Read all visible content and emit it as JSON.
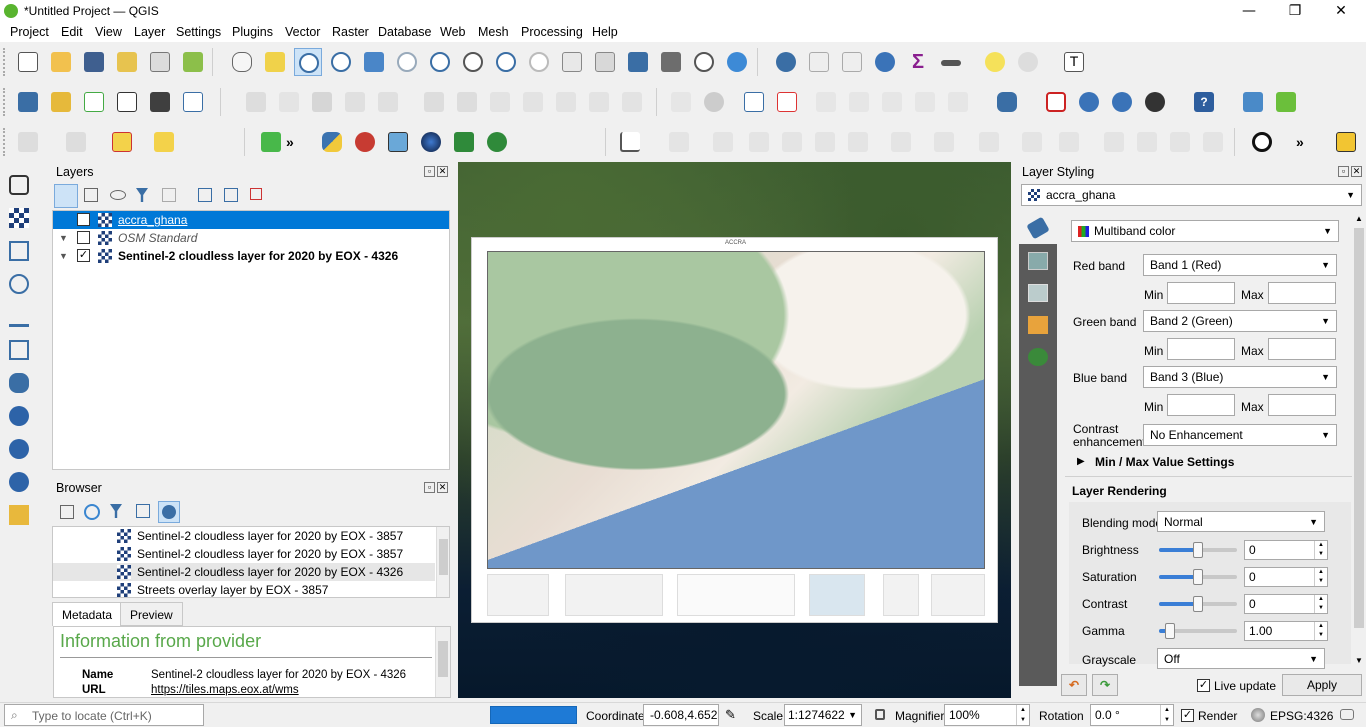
{
  "window": {
    "title": "*Untitled Project — QGIS"
  },
  "menu": [
    "Project",
    "Edit",
    "View",
    "Layer",
    "Settings",
    "Plugins",
    "Vector",
    "Raster",
    "Database",
    "Web",
    "Mesh",
    "Processing",
    "Help"
  ],
  "layers_panel": {
    "title": "Layers",
    "items": [
      {
        "name": "accra_ghana",
        "checked": "✓",
        "selected": true
      },
      {
        "name": "OSM Standard",
        "checked": "",
        "selected": false
      },
      {
        "name": "Sentinel-2 cloudless layer for 2020 by EOX - 4326",
        "checked": "✓",
        "selected": false
      }
    ]
  },
  "browser_panel": {
    "title": "Browser",
    "items": [
      "Sentinel-2 cloudless layer for 2020 by EOX - 3857",
      "Sentinel-2 cloudless layer for 2020 by EOX - 3857",
      "Sentinel-2 cloudless layer for 2020 by EOX - 4326",
      "Streets overlay layer by EOX - 3857"
    ]
  },
  "metadata": {
    "tabs": [
      "Metadata",
      "Preview"
    ],
    "heading": "Information from provider",
    "name_label": "Name",
    "name_value": "Sentinel-2 cloudless layer for 2020 by EOX - 4326",
    "url_label": "URL",
    "url_value": "https://tiles.maps.eox.at/wms"
  },
  "map": {
    "sheet_title": "ACCRA"
  },
  "styling": {
    "title": "Layer Styling",
    "layer": "accra_ghana",
    "renderer": "Multiband color",
    "red_label": "Red band",
    "red_value": "Band 1 (Red)",
    "green_label": "Green band",
    "green_value": "Band 2 (Green)",
    "blue_label": "Blue band",
    "blue_value": "Band 3 (Blue)",
    "min_label": "Min",
    "max_label": "Max",
    "contrast_label_1": "Contrast",
    "contrast_label_2": "enhancement",
    "contrast_value": "No Enhancement",
    "minmax_label": "Min / Max Value Settings",
    "rendering_label": "Layer Rendering",
    "blending_label": "Blending mode",
    "blending_value": "Normal",
    "brightness_label": "Brightness",
    "brightness_value": "0",
    "saturation_label": "Saturation",
    "saturation_value": "0",
    "contrast2_label": "Contrast",
    "contrast2_value": "0",
    "gamma_label": "Gamma",
    "gamma_value": "1.00",
    "grayscale_label": "Grayscale",
    "grayscale_value": "Off",
    "live_update_label": "Live update",
    "apply_label": "Apply"
  },
  "status": {
    "locate_placeholder": "Type to locate (Ctrl+K)",
    "coordinate_label": "Coordinate",
    "coordinate_value": "-0.608,4.652",
    "scale_label": "Scale",
    "scale_value": "1:1274622",
    "magnifier_label": "Magnifier",
    "magnifier_value": "100%",
    "rotation_label": "Rotation",
    "rotation_value": "0.0 °",
    "render_label": "Render",
    "crs_value": "EPSG:4326"
  },
  "colors": {
    "selection": "#0078d7",
    "progress": "#1e7ad6",
    "qgis_green": "#59b42f"
  }
}
